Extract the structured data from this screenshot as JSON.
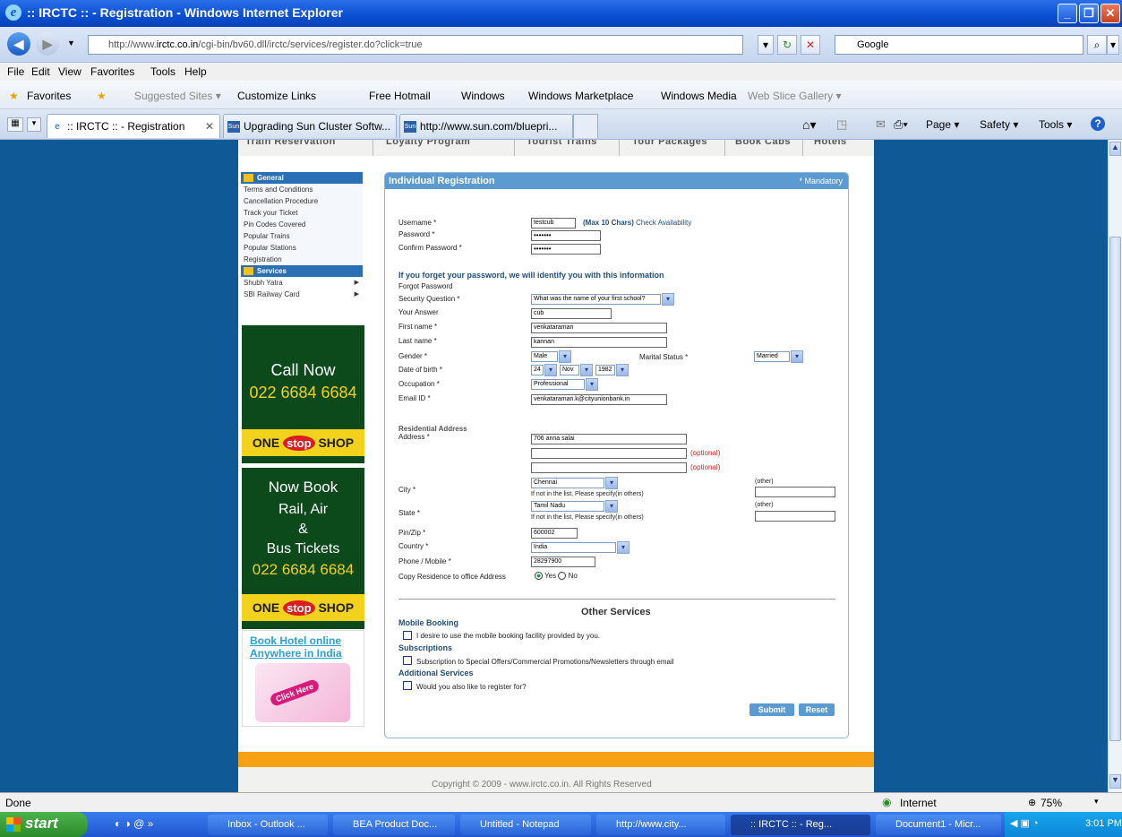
{
  "window": {
    "title": ":: IRCTC :: - Registration - Windows Internet Explorer"
  },
  "address_bar": {
    "url_prefix": "http://www.",
    "url_domain": "irctc.co.in",
    "url_path": "/cgi-bin/bv60.dll/irctc/services/register.do?click=true",
    "search_engine": "Google"
  },
  "menu": [
    "File",
    "Edit",
    "View",
    "Favorites",
    "Tools",
    "Help"
  ],
  "favorites_bar": {
    "favorites": "Favorites",
    "links": [
      "Suggested Sites ▾",
      "Customize Links",
      "Free Hotmail",
      "Windows",
      "Windows Marketplace",
      "Windows Media",
      "Web Slice Gallery ▾"
    ]
  },
  "tabs": [
    ":: IRCTC :: - Registration",
    "Upgrading Sun Cluster Softw...",
    "http://www.sun.com/bluepri..."
  ],
  "command_bar": {
    "page": "Page ▾",
    "safety": "Safety ▾",
    "tools": "Tools ▾"
  },
  "site_nav": [
    "Train Reservation",
    "Loyalty Program",
    "Tourist Trains",
    "Tour Packages",
    "Book Cabs",
    "Hotels"
  ],
  "sidebar": {
    "general": "General",
    "general_items": [
      "Terms and Conditions",
      "Cancellation Procedure",
      "Track your Ticket",
      "Pin Codes Covered",
      "Popular Trains",
      "Popular Stations",
      "Registration"
    ],
    "services": "Services",
    "services_items": [
      "Shubh Yatra",
      "SBI Railway Card"
    ]
  },
  "ads": {
    "call_now": "Call Now",
    "phone": "022 6684 6684",
    "one": "ONE",
    "stop": "stop",
    "shop": "SHOP",
    "now_book": "Now Book",
    "rail_air": "Rail, Air",
    "amp": "&",
    "bus": "Bus Tickets",
    "hotel_line1": "Book Hotel online",
    "hotel_line2": "Anywhere in India",
    "click_here": "Click Here"
  },
  "form": {
    "title": "Individual Registration",
    "mandatory": "* Mandatory",
    "username_label": "Username *",
    "username_value": "testcub",
    "max_chars": "(Max 10 Chars)",
    "check_availability": "Check Availability",
    "password_label": "Password *",
    "password_value": "•••••••",
    "confirm_label": "Confirm Password *",
    "confirm_value": "•••••••",
    "forget_heading": "If you forget your password, we will identify you with this information",
    "forgot_password": "Forgot Password",
    "security_question_label": "Security Question *",
    "security_question_value": "What was the name of your first school?",
    "answer_label": "Your Answer",
    "answer_value": "cub",
    "first_name_label": "First name *",
    "first_name_value": "venkataraman",
    "last_name_label": "Last name *",
    "last_name_value": "kannan",
    "gender_label": "Gender *",
    "gender_value": "Male",
    "marital_label": "Marital Status *",
    "marital_value": "Married",
    "dob_label": "Date of birth *",
    "dob_day": "24",
    "dob_month": "Nov",
    "dob_year": "1982",
    "occupation_label": "Occupation *",
    "occupation_value": "Professional",
    "email_label": "Email ID *",
    "email_value": "venkataraman.k@cityunionbank.in",
    "residential_heading": "Residential Address",
    "address_label": "Address *",
    "address1": "706 anna salai",
    "optional": "(optional)",
    "city_label": "City *",
    "city_value": "Chennai",
    "other": "(other)",
    "not_in_list": "If not in the list, Please specify(in others)",
    "state_label": "State *",
    "state_value": "Tamil Nadu",
    "pin_label": "Pin/Zip *",
    "pin_value": "600002",
    "country_label": "Country *",
    "country_value": "India",
    "phone_label": "Phone / Mobile *",
    "phone_value": "28297900",
    "copy_label": "Copy Residence to office Address",
    "yes": "Yes",
    "no": "No",
    "other_services": "Other Services",
    "mobile_booking": "Mobile Booking",
    "mobile_desc": "I desire to use the mobile booking facility provided by you.",
    "subscriptions": "Subscriptions",
    "subs_desc": "Subscription to Special Offers/Commercial Promotions/Newsletters through email",
    "additional": "Additional Services",
    "additional_desc": "Would you also like to register for?",
    "submit": "Submit",
    "reset": "Reset"
  },
  "footer": "Copyright © 2009 - www.irctc.co.in. All Rights Reserved",
  "statusbar": {
    "text": "Done",
    "zone": "Internet",
    "zoom": "75%"
  },
  "taskbar": {
    "start": "start",
    "tasks": [
      "Inbox - Outlook ...",
      "BEA Product Doc...",
      "Untitled - Notepad",
      "http://www.city...",
      ":: IRCTC :: - Reg...",
      "Document1 - Micr..."
    ],
    "clock": "3:01 PM"
  }
}
